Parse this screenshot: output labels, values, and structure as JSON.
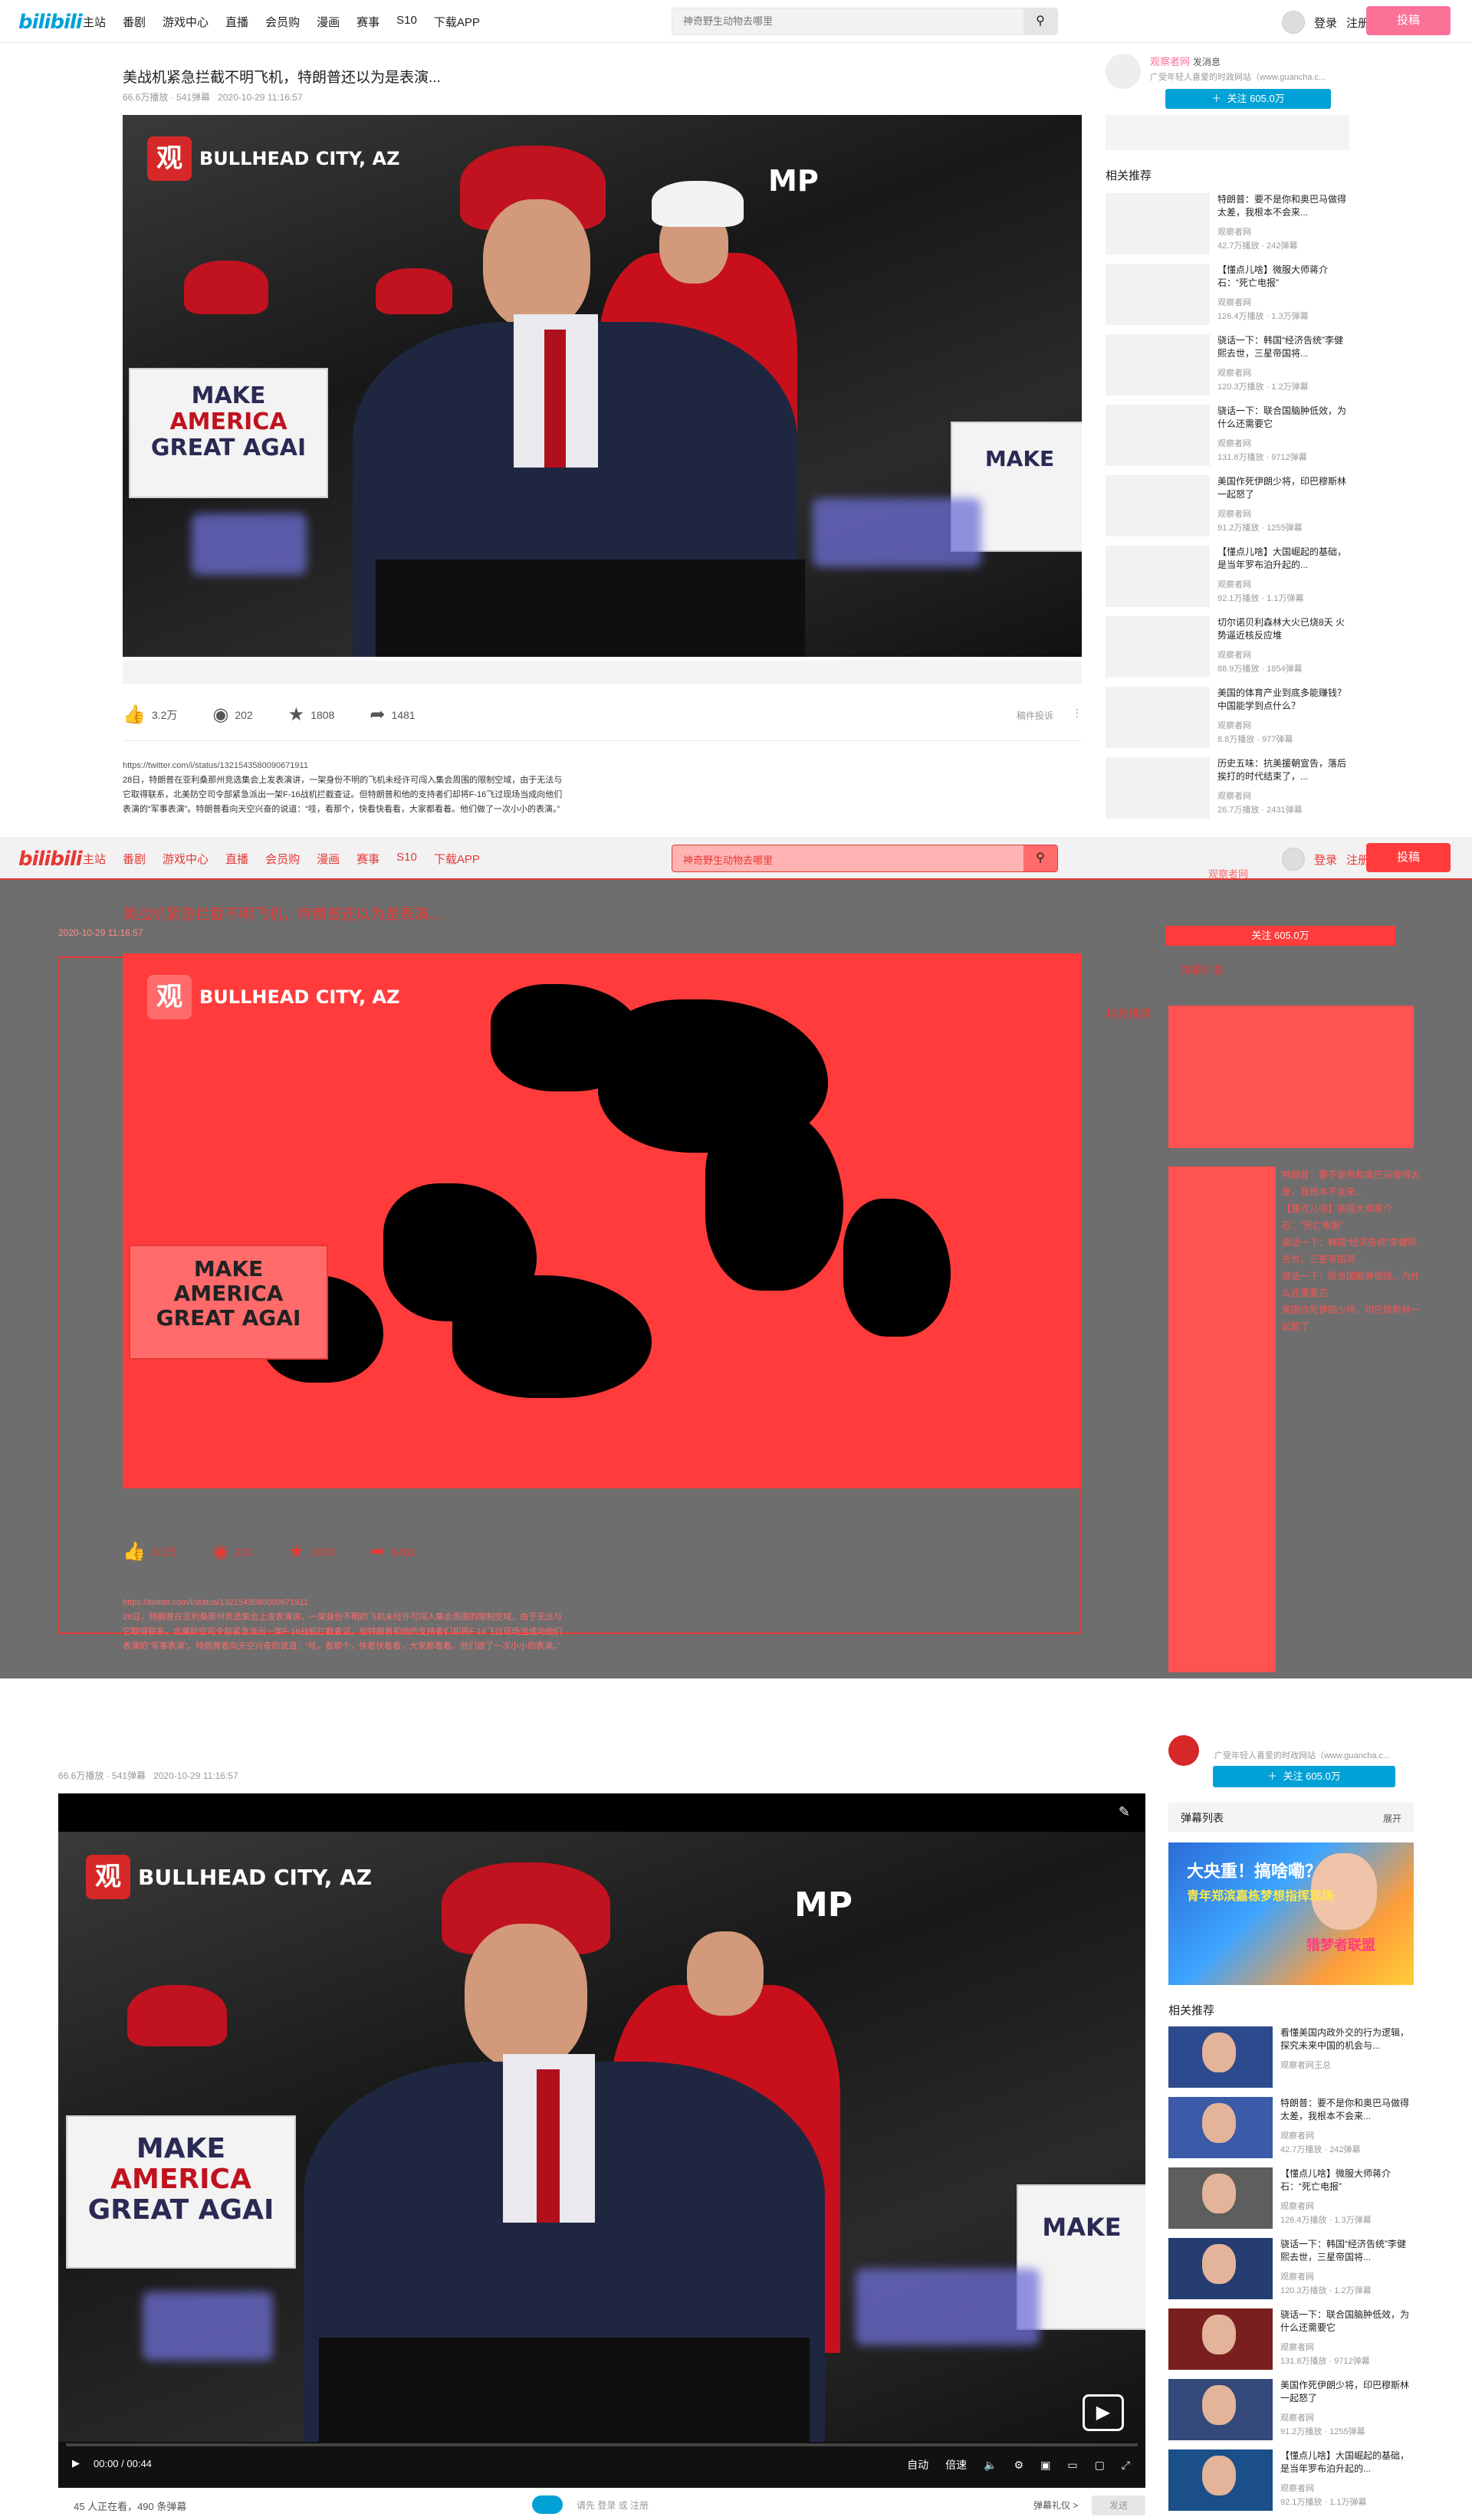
{
  "nav": {
    "logo": "bilibili",
    "items": [
      "主站",
      "番剧",
      "游戏中心",
      "直播",
      "会员购",
      "漫画",
      "赛事",
      "S10",
      "下载APP"
    ],
    "search_placeholder": "神奇野生动物去哪里",
    "login": "登录",
    "register": "注册",
    "upload": "投稿"
  },
  "video": {
    "title": "美战机紧急拦截不明飞机，特朗普还以为是表演...",
    "views": "66.6万播放",
    "danmaku": "541弹幕",
    "date": "2020-10-29 11:16:57",
    "scene_location": "BULLHEAD CITY, AZ",
    "scene_logo": "观",
    "sign_lines": [
      "MAKE",
      "AMERICA",
      "GREAT AGAI"
    ],
    "hat_text": "MAKE AMERICA GREAT AGAIN",
    "shirt_text": "MP"
  },
  "actions": {
    "like": "3.2万",
    "coin": "202",
    "favorite": "1808",
    "share": "1481",
    "report": "稿件投诉"
  },
  "description": {
    "link": "https://twitter.com/i/status/1321543580090671911",
    "text": "28日，特朗普在亚利桑那州竞选集会上发表演讲，一架身份不明的飞机未经许可闯入集会周围的限制空域，由于无法与它取得联系，北美防空司令部紧急派出一架F-16战机拦截查证。但特朗普和他的支持者们却将F-16飞过现场当成向他们表演的“军事表演”。特朗普看向天空兴奋的说道：“哇，看那个，快看快看看，大家都看着。他们做了一次小小的表演。”"
  },
  "uploader": {
    "name": "观察者网",
    "message": "发消息",
    "desc": "广受年轻人喜爱的时政网站（www.guancha.c...",
    "follow": "关注 605.0万"
  },
  "sidebar": {
    "danmaku_list": "弹幕列表",
    "expand": "展开",
    "recommend_title": "相关推荐",
    "items": [
      {
        "title": "特朗普：要不是你和奥巴马做得太差，我根本不会来...",
        "author": "观察者网",
        "stats": "42.7万播放 · 242弹幕"
      },
      {
        "title": "【懂点儿啥】微服大师蒋介石：“死亡电报”",
        "author": "观察者网",
        "stats": "126.4万播放 · 1.3万弹幕"
      },
      {
        "title": "骁话一下：韩国“经济告统”李健熙去世，三星帝国将...",
        "author": "观察者网",
        "stats": "120.3万播放 · 1.2万弹幕"
      },
      {
        "title": "骁话一下：联合国脑肿低效，为什么还需要它",
        "author": "观察者网",
        "stats": "131.8万播放 · 9712弹幕"
      },
      {
        "title": "美国作死伊朗少将，印巴穆斯林一起怒了",
        "author": "观察者网",
        "stats": "91.2万播放 · 1255弹幕"
      },
      {
        "title": "【懂点儿啥】大国崛起的基础，是当年罗布泊升起的...",
        "author": "观察者网",
        "stats": "92.1万播放 · 1.1万弹幕"
      },
      {
        "title": "切尔诺贝利森林大火已烧8天 火势逼近核反应堆",
        "author": "观察者网",
        "stats": "88.9万播放 · 1854弹幕"
      },
      {
        "title": "美国的体育产业到底多能赚钱？中国能学到点什么？",
        "author": "观察者网",
        "stats": "8.8万播放 · 977弹幕"
      },
      {
        "title": "历史五味：抗美援朝宣告，落后挨打的时代结束了，...",
        "author": "观察者网",
        "stats": "26.7万播放 · 2431弹幕"
      }
    ]
  },
  "section3": {
    "first_rec": "看懂美国内政外交的行为逻辑，探究未来中国的机会与...",
    "first_rec_author": "观察者网王总",
    "time": "00:00 / 00:44",
    "auto": "自动",
    "quality": "倍速",
    "watching": "45 人正在看，490 条弹幕",
    "login_tip": "请先 登录 或 注册",
    "etiquette": "弹幕礼仪 >",
    "send": "发送",
    "ad_t1": "大央重！搞啥嘞？",
    "ad_t2": "青年郑滨嘉栋梦想指挥现场",
    "ad_t3": "猎梦者联盟"
  },
  "colors": {
    "brand": "#00a1d6",
    "pink": "#fb7299",
    "overlay_red": "#ff3b3b",
    "overlay_gray": "#6e6e6e"
  }
}
